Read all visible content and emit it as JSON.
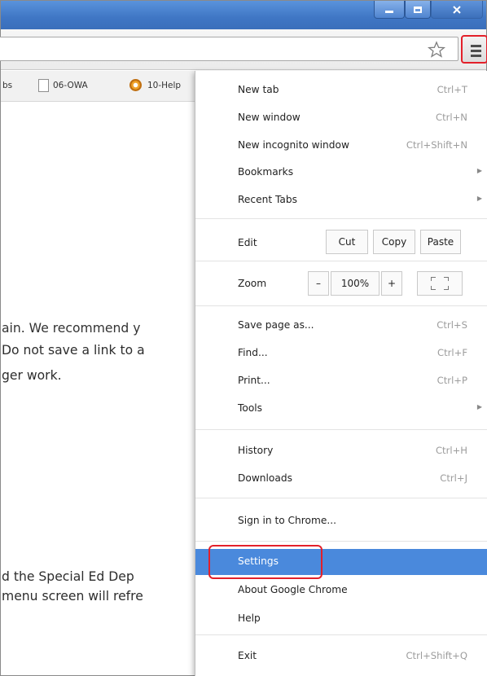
{
  "bookmarks": {
    "items": [
      {
        "label": "bs"
      },
      {
        "label": "06-OWA"
      },
      {
        "label": "10-Help"
      }
    ]
  },
  "content": {
    "lines": [
      "ain. We recommend y",
      "Do not save a link to a",
      "ger work.",
      "d the Special Ed Dep",
      "menu screen will refre"
    ]
  },
  "menu": {
    "items": {
      "new_tab": {
        "label": "New tab",
        "shortcut": "Ctrl+T"
      },
      "new_window": {
        "label": "New window",
        "shortcut": "Ctrl+N"
      },
      "new_incognito": {
        "label": "New incognito window",
        "shortcut": "Ctrl+Shift+N"
      },
      "bookmarks": {
        "label": "Bookmarks"
      },
      "recent_tabs": {
        "label": "Recent Tabs"
      },
      "edit": {
        "label": "Edit",
        "cut": "Cut",
        "copy": "Copy",
        "paste": "Paste"
      },
      "zoom": {
        "label": "Zoom",
        "minus": "–",
        "level": "100%",
        "plus": "+"
      },
      "save_page": {
        "label": "Save page as...",
        "shortcut": "Ctrl+S"
      },
      "find": {
        "label": "Find...",
        "shortcut": "Ctrl+F"
      },
      "print": {
        "label": "Print...",
        "shortcut": "Ctrl+P"
      },
      "tools": {
        "label": "Tools"
      },
      "history": {
        "label": "History",
        "shortcut": "Ctrl+H"
      },
      "downloads": {
        "label": "Downloads",
        "shortcut": "Ctrl+J"
      },
      "sign_in": {
        "label": "Sign in to Chrome..."
      },
      "settings": {
        "label": "Settings"
      },
      "about": {
        "label": "About Google Chrome"
      },
      "help": {
        "label": "Help"
      },
      "exit": {
        "label": "Exit",
        "shortcut": "Ctrl+Shift+Q"
      }
    }
  },
  "colors": {
    "highlight": "#4a89dc",
    "callout": "#e3202a",
    "titlebar": "#3f76c4"
  },
  "icons": {
    "star": "bookmark-star-icon",
    "menu": "hamburger-menu-icon",
    "submenu": "chevron-right-icon",
    "fullscreen": "fullscreen-icon"
  }
}
